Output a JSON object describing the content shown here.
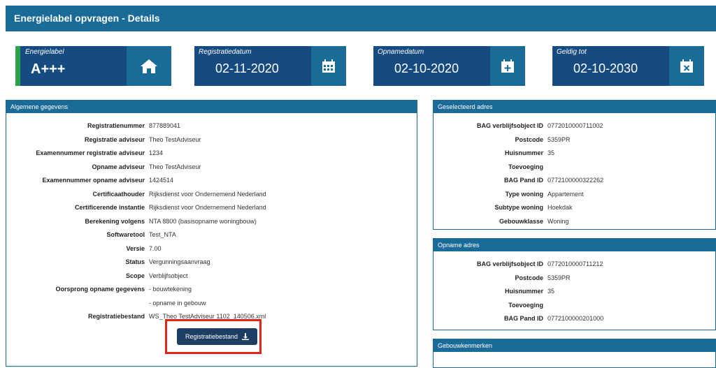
{
  "header": {
    "title": "Energielabel opvragen - Details"
  },
  "cards": {
    "energielabel": {
      "label": "Energielabel",
      "value": "A+++",
      "icon": "home-icon"
    },
    "registratiedatum": {
      "label": "Registratiedatum",
      "value": "02-11-2020",
      "icon": "calendar-grid-icon"
    },
    "opnamedatum": {
      "label": "Opnamedatum",
      "value": "02-10-2020",
      "icon": "calendar-plus-icon"
    },
    "geldigtot": {
      "label": "Geldig tot",
      "value": "02-10-2030",
      "icon": "calendar-x-icon"
    }
  },
  "algemeen": {
    "title": "Algemene gegevens",
    "rows": [
      {
        "k": "Registratienummer",
        "v": "877889041"
      },
      {
        "k": "Registratie adviseur",
        "v": "Theo TestAdviseur"
      },
      {
        "k": "Examennummer registratie adviseur",
        "v": "1234"
      },
      {
        "k": "Opname adviseur",
        "v": "Theo TestAdviseur"
      },
      {
        "k": "Examennummer opname adviseur",
        "v": "1424514"
      },
      {
        "k": "Certificaathouder",
        "v": "Rijksdienst voor Ondernemend Nederland"
      },
      {
        "k": "Certificerende instantie",
        "v": "Rijksdienst voor Ondernemend Nederland"
      },
      {
        "k": "Berekening volgens",
        "v": "NTA 8800 (basisopname woningbouw)"
      },
      {
        "k": "Softwaretool",
        "v": "Test_NTA"
      },
      {
        "k": "Versie",
        "v": "7.00"
      },
      {
        "k": "Status",
        "v": "Vergunningsaanvraag"
      },
      {
        "k": "Scope",
        "v": "Verblijfsobject"
      },
      {
        "k": "Oorsprong opname gegevens",
        "v": "- bouwtekening"
      },
      {
        "k": "",
        "v": "- opname in gebouw"
      },
      {
        "k": "Registratiebestand",
        "v": "WS_Theo TestAdviseur 1102_140506.xml"
      }
    ],
    "download_label": "Registratiebestand"
  },
  "geselecteerd": {
    "title": "Geselecteerd adres",
    "rows": [
      {
        "k": "BAG verblijfsobject ID",
        "v": "0772010000711002"
      },
      {
        "k": "Postcode",
        "v": "5359PR"
      },
      {
        "k": "Huisnummer",
        "v": "35"
      },
      {
        "k": "Toevoeging",
        "v": ""
      },
      {
        "k": "BAG Pand ID",
        "v": "0772100000322262"
      },
      {
        "k": "Type woning",
        "v": "Appartement"
      },
      {
        "k": "Subtype woning",
        "v": "Hoekdak"
      },
      {
        "k": "Gebouwklasse",
        "v": "Woning"
      }
    ]
  },
  "opname": {
    "title": "Opname adres",
    "rows": [
      {
        "k": "BAG verblijfsobject ID",
        "v": "0772010000711212"
      },
      {
        "k": "Postcode",
        "v": "5359PR"
      },
      {
        "k": "Huisnummer",
        "v": "35"
      },
      {
        "k": "Toevoeging",
        "v": ""
      },
      {
        "k": "BAG Pand ID",
        "v": "0772100000201000"
      }
    ]
  },
  "gebouwkenmerken": {
    "title": "Gebouwkenmerken"
  },
  "colors": {
    "header": "#1b6b98",
    "card": "#164b82",
    "green": "#2ca24b",
    "highlight": "#e2231a"
  }
}
